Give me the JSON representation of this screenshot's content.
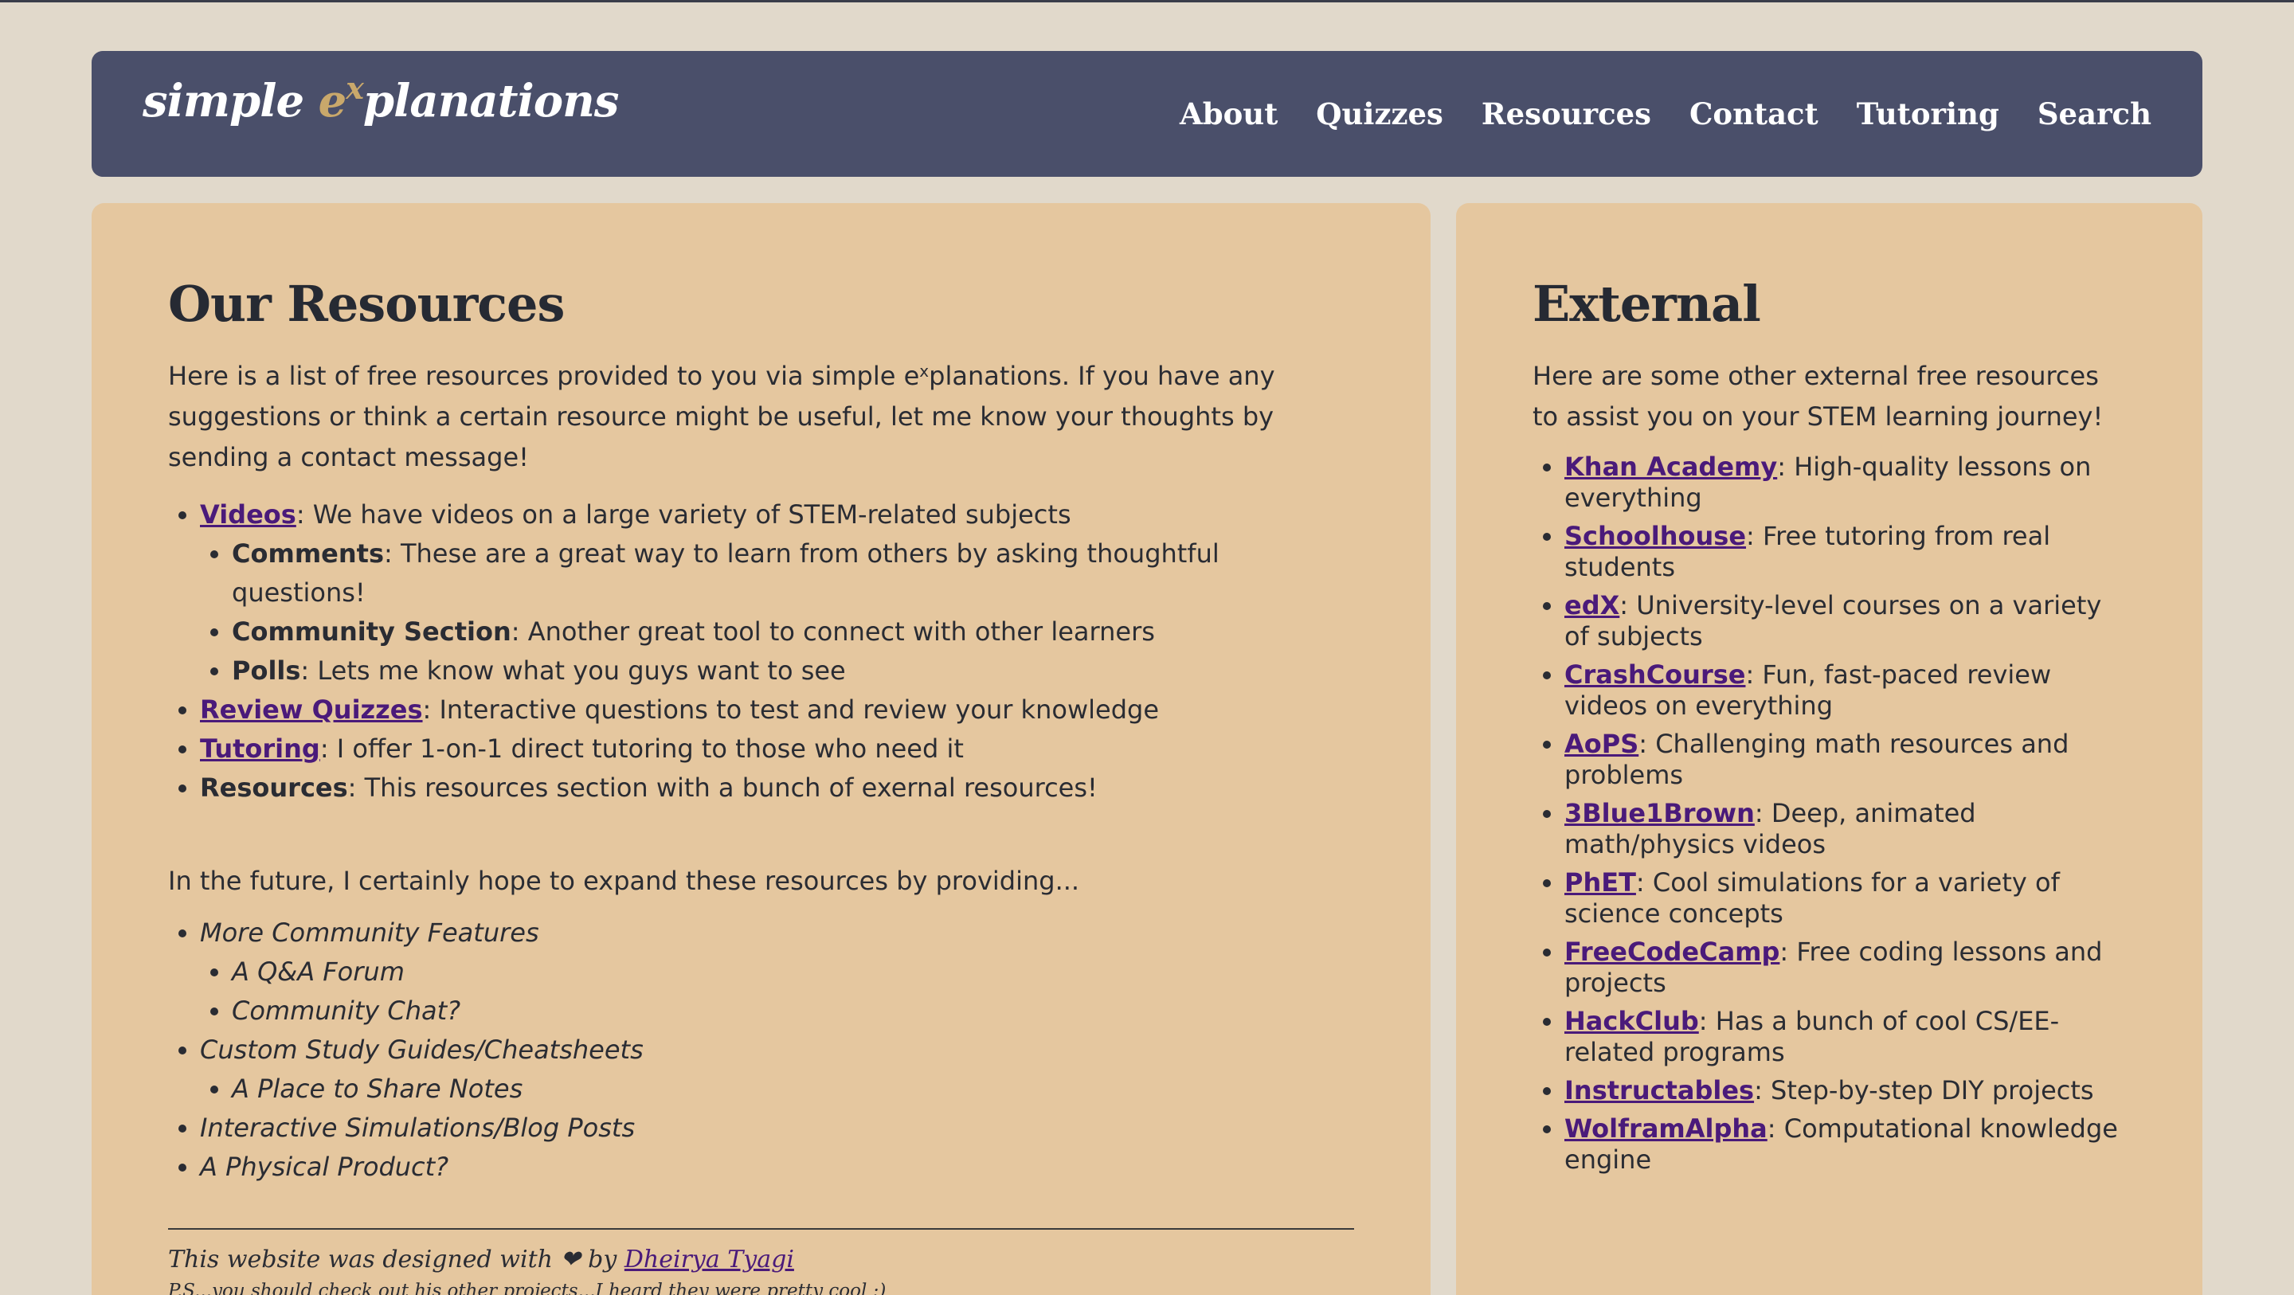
{
  "brand": {
    "part1": "simple ",
    "accent": "e",
    "sup": "x",
    "part2": "planations"
  },
  "nav": {
    "items": [
      "About",
      "Quizzes",
      "Resources",
      "Contact",
      "Tutoring",
      "Search"
    ]
  },
  "main": {
    "title": "Our Resources",
    "intro_a": "Here is a list of free resources provided to you via simple e",
    "intro_sup": "x",
    "intro_b": "planations. If you have any suggestions or think a certain resource might be useful, let me know your thoughts by sending a contact message!",
    "resources": {
      "videos": {
        "label": "Videos",
        "desc": ": We have videos on a large variety of STEM-related subjects"
      },
      "comments": {
        "label": "Comments",
        "desc": ": These are a great way to learn from others by asking thoughtful questions!"
      },
      "community": {
        "label": "Community Section",
        "desc": ": Another great tool to connect with other learners"
      },
      "polls": {
        "label": "Polls",
        "desc": ": Lets me know what you guys want to see"
      },
      "quizzes": {
        "label": "Review Quizzes",
        "desc": ": Interactive questions to test and review your knowledge"
      },
      "tutoring": {
        "label": "Tutoring",
        "desc": ": I offer 1-on-1 direct tutoring to those who need it"
      },
      "resources": {
        "label": "Resources",
        "desc": ": This resources section with a bunch of exernal resources!"
      }
    },
    "future_intro": "In the future, I certainly hope to expand these resources by providing...",
    "future": {
      "community_features": "More Community Features",
      "qa_forum": "A Q&A Forum",
      "community_chat": "Community Chat?",
      "study_guides": "Custom Study Guides/Cheatsheets",
      "share_notes": "A Place to Share Notes",
      "simulations": "Interactive Simulations/Blog Posts",
      "physical": "A Physical Product?"
    },
    "footer": {
      "text": "This website was designed with ❤ by ",
      "author": "Dheirya Tyagi",
      "ps": "P.S...you should check out his other projects...I heard they were pretty cool :)"
    }
  },
  "side": {
    "title": "External",
    "intro": "Here are some other external free resources to assist you on your STEM learning journey!",
    "items": [
      {
        "label": "Khan Academy",
        "desc": ": High-quality lessons on everything"
      },
      {
        "label": "Schoolhouse",
        "desc": ": Free tutoring from real students"
      },
      {
        "label": "edX",
        "desc": ": University-level courses on a variety of subjects"
      },
      {
        "label": "CrashCourse",
        "desc": ": Fun, fast-paced review videos on everything"
      },
      {
        "label": "AoPS",
        "desc": ": Challenging math resources and problems"
      },
      {
        "label": "3Blue1Brown",
        "desc": ": Deep, animated math/physics videos"
      },
      {
        "label": "PhET",
        "desc": ": Cool simulations for a variety of science concepts"
      },
      {
        "label": "FreeCodeCamp",
        "desc": ": Free coding lessons and projects"
      },
      {
        "label": "HackClub",
        "desc": ": Has a bunch of cool CS/EE-related programs"
      },
      {
        "label": "Instructables",
        "desc": ": Step-by-step DIY projects"
      },
      {
        "label": "WolframAlpha",
        "desc": ": Computational knowledge engine"
      }
    ]
  },
  "colors": {
    "page_bg": "#e1d9cb",
    "header_bg": "#4a4f6a",
    "card_bg": "#e5c79f",
    "link": "#4a1a7a",
    "brand_accent": "#c9a86b"
  }
}
